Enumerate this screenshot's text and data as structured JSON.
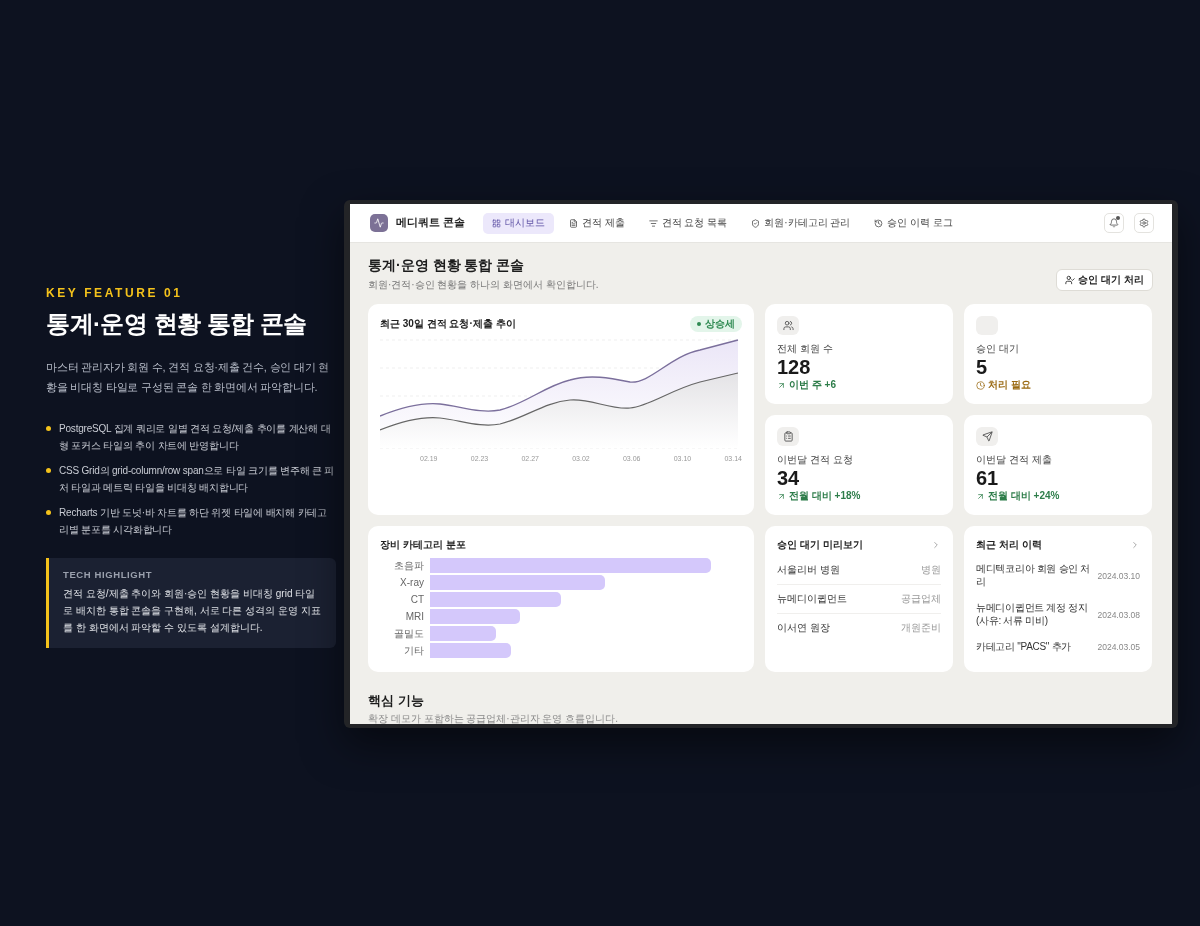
{
  "intro": {
    "eyebrow": "KEY FEATURE 01",
    "title": "통계·운영 현황 통합 콘솔",
    "description": "마스터 관리자가 회원 수, 견적 요청·제출 건수, 승인 대기 현황을 비대칭 타일로 구성된 콘솔 한 화면에서 파악합니다.",
    "bullets": [
      "PostgreSQL 집계 쿼리로 일별 견적 요청/제출 추이를 계산해 대형 포커스 타일의 추이 차트에 반영합니다",
      "CSS Grid의 grid-column/row span으로 타일 크기를 변주해 큰 피처 타일과 메트릭 타일을 비대칭 배치합니다",
      "Recharts 기반 도넛·바 차트를 하단 위젯 타일에 배치해 카테고리별 분포를 시각화합니다"
    ],
    "highlight": {
      "label": "TECH HIGHLIGHT",
      "text": "견적 요청/제출 추이와 회원·승인 현황을 비대칭 grid 타일로 배치한 통합 콘솔을 구현해, 서로 다른 성격의 운영 지표를 한 화면에서 파악할 수 있도록 설계합니다."
    }
  },
  "app": {
    "brand": "메디쿼트 콘솔",
    "nav": [
      {
        "label": "대시보드",
        "selected": true
      },
      {
        "label": "견적 제출",
        "selected": false
      },
      {
        "label": "견적 요청 목록",
        "selected": false
      },
      {
        "label": "회원·카테고리 관리",
        "selected": false
      },
      {
        "label": "승인 이력 로그",
        "selected": false
      }
    ],
    "notifications_unread": true,
    "page_title": "통계·운영 현황 통합 콘솔",
    "page_subtitle": "회원·견적·승인 현황을 하나의 화면에서 확인합니다.",
    "action_button": "승인 대기 처리",
    "trend_card": {
      "title": "최근 30일 견적 요청·제출 추이",
      "badge": "상승세",
      "x_labels": [
        "02.19",
        "02.23",
        "02.27",
        "03.02",
        "03.06",
        "03.10",
        "03.14"
      ]
    },
    "stats": [
      {
        "label": "전체 회원 수",
        "value": "128",
        "note": "이번 주 +6",
        "kind": "up"
      },
      {
        "label": "승인 대기",
        "value": "5",
        "note": "처리 필요",
        "kind": "warn"
      },
      {
        "label": "이번달 견적 요청",
        "value": "34",
        "note": "전월 대비 +18%",
        "kind": "up"
      },
      {
        "label": "이번달 견적 제출",
        "value": "61",
        "note": "전월 대비 +24%",
        "kind": "up"
      }
    ],
    "category_card": {
      "title": "장비 카테고리 분포",
      "categories": [
        {
          "name": "초음파"
        },
        {
          "name": "X-ray"
        },
        {
          "name": "CT"
        },
        {
          "name": "MRI"
        },
        {
          "name": "골밀도"
        },
        {
          "name": "기타"
        }
      ]
    },
    "pending": {
      "title": "승인 대기 미리보기",
      "rows": [
        {
          "name": "서울리버 병원",
          "tag": "병원"
        },
        {
          "name": "뉴메디이큅먼트",
          "tag": "공급업체"
        },
        {
          "name": "이서연 원장",
          "tag": "개원준비"
        }
      ]
    },
    "history": {
      "title": "최근 처리 이력",
      "rows": [
        {
          "text": "메디텍코리아 회원 승인 처리",
          "date": "2024.03.10"
        },
        {
          "text": "뉴메디이큅먼트 계정 정지 (사유: 서류 미비)",
          "date": "2024.03.08"
        },
        {
          "text": "카테고리 \"PACS\" 추가",
          "date": "2024.03.05"
        }
      ]
    },
    "section": {
      "title": "핵심 기능",
      "subtitle": "확장 데모가 포함하는 공급업체·관리자 운영 흐름입니다."
    }
  }
}
